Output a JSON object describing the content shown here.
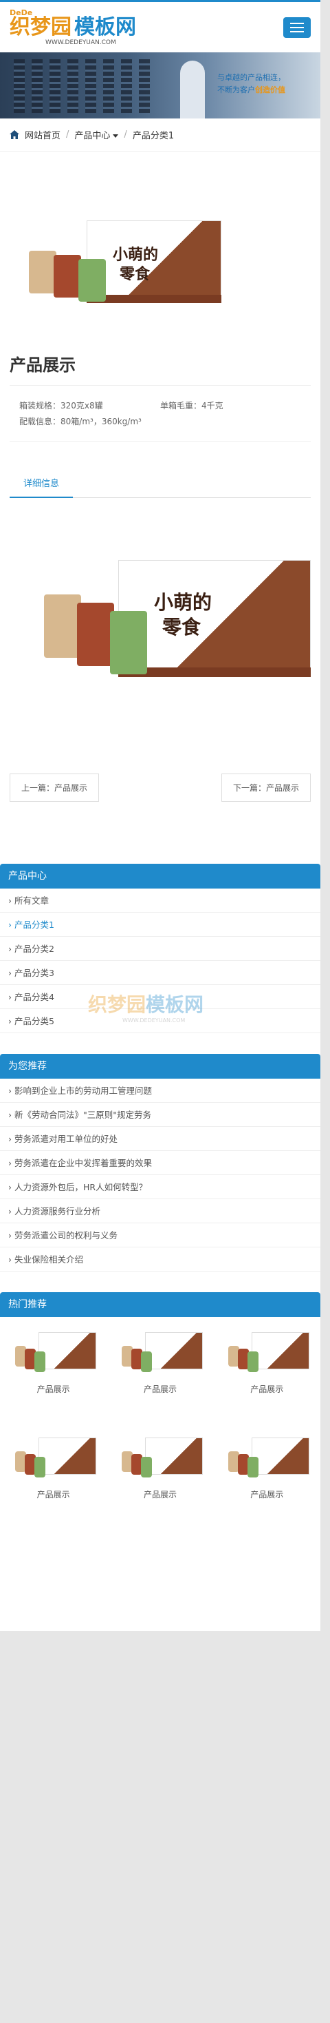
{
  "header": {
    "logo_top": "DeDe",
    "logo_cn_a": "织梦园",
    "logo_cn_b": "模板网",
    "logo_url": "WWW.DEDEYUAN.COM"
  },
  "banner": {
    "line1_a": "与卓越的产品相连，",
    "line2_a": "不断为客户",
    "line2_b": "创造价值"
  },
  "breadcrumb": {
    "home": "网站首页",
    "section": "产品中心",
    "current": "产品分类1"
  },
  "product": {
    "title": "产品展示",
    "spec1_label": "箱装规格：320克x8罐",
    "spec2_label": "单箱毛重：4千克",
    "spec3_label": "配载信息：80箱/m³，360kg/m³",
    "box_text_a": "小萌的",
    "box_text_b": "零食"
  },
  "tabs": {
    "detail": "详细信息"
  },
  "pager": {
    "prev": "上一篇：产品展示",
    "next": "下一篇：产品展示"
  },
  "product_center": {
    "title": "产品中心",
    "items": [
      "所有文章",
      "产品分类1",
      "产品分类2",
      "产品分类3",
      "产品分类4",
      "产品分类5"
    ]
  },
  "recommend": {
    "title": "为您推荐",
    "items": [
      "影响到企业上市的劳动用工管理问题",
      "新《劳动合同法》\"三原则\"规定劳务",
      "劳务派遣对用工单位的好处",
      "劳务派遣在企业中发挥着重要的效果",
      "人力资源外包后，HR人如何转型？",
      "人力资源服务行业分析",
      "劳务派遣公司的权利与义务",
      "失业保险相关介绍"
    ]
  },
  "hot": {
    "title": "热门推荐",
    "items": [
      "产品展示",
      "产品展示",
      "产品展示",
      "产品展示",
      "产品展示",
      "产品展示"
    ]
  },
  "watermark": {
    "a": "织梦园",
    "b": "模板网",
    "url": "WWW.DEDEYUAN.COM"
  },
  "colors": {
    "accent": "#1f8acb",
    "brand_orange": "#e8961a",
    "box_brown": "#7a3b22"
  }
}
